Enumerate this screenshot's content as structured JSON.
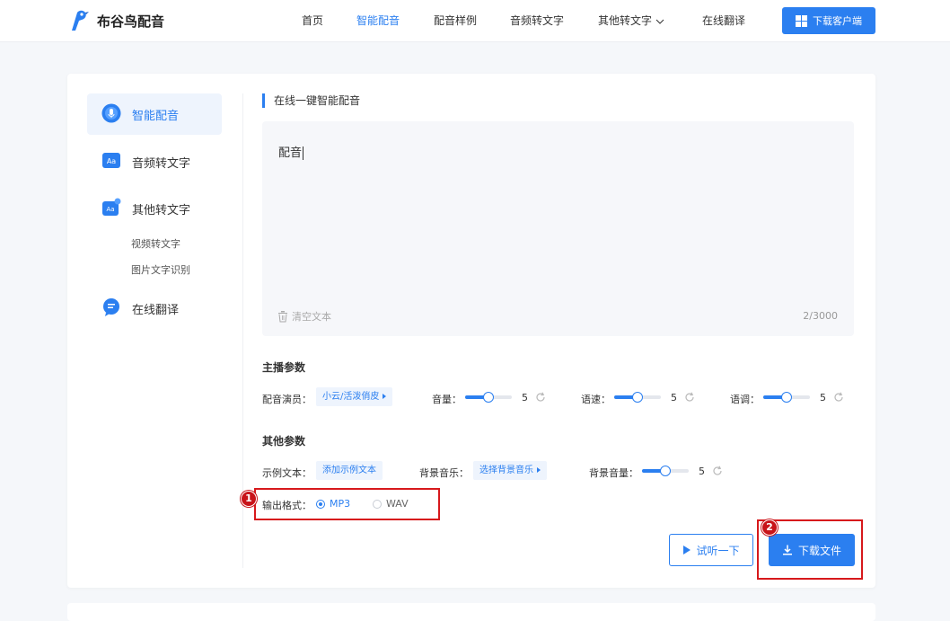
{
  "header": {
    "logo_text": "布谷鸟配音",
    "nav": [
      {
        "label": "首页",
        "active": false
      },
      {
        "label": "智能配音",
        "active": true
      },
      {
        "label": "配音样例",
        "active": false
      },
      {
        "label": "音频转文字",
        "active": false
      },
      {
        "label": "其他转文字",
        "active": false,
        "has_dropdown": true
      },
      {
        "label": "在线翻译",
        "active": false
      }
    ],
    "download_client_label": "下载客户端"
  },
  "sidebar": {
    "items": [
      {
        "label": "智能配音",
        "icon": "mic-icon",
        "active": true
      },
      {
        "label": "音频转文字",
        "icon": "aa-text-icon",
        "active": false
      },
      {
        "label": "其他转文字",
        "icon": "aa-convert-icon",
        "active": false
      },
      {
        "label": "在线翻译",
        "icon": "translate-chat-icon",
        "active": false
      }
    ],
    "subitems": [
      "视频转文字",
      "图片文字识别"
    ]
  },
  "main": {
    "section_title": "在线一键智能配音",
    "textarea": {
      "text": "配音",
      "clear_label": "清空文本",
      "counter": "2/3000"
    },
    "anchor_params": {
      "title": "主播参数",
      "voice_label": "配音演员：",
      "voice_value": "小云/活泼俏皮",
      "volume_label": "音量：",
      "volume_value": "5",
      "speed_label": "语速：",
      "speed_value": "5",
      "pitch_label": "语调：",
      "pitch_value": "5",
      "level_fraction": 0.5
    },
    "other_params": {
      "title": "其他参数",
      "sample_text_label": "示例文本：",
      "sample_text_btn": "添加示例文本",
      "bgm_label": "背景音乐：",
      "bgm_btn": "选择背景音乐",
      "bgm_volume_label": "背景音量：",
      "bgm_volume_value": "5",
      "format_label": "输出格式：",
      "formats": [
        {
          "label": "MP3",
          "selected": true
        },
        {
          "label": "WAV",
          "selected": false
        }
      ]
    },
    "preview_label": "试听一下",
    "download_label": "下载文件"
  },
  "annotations": {
    "marker1": "1",
    "marker2": "2"
  },
  "colors": {
    "accent": "#2b7ff0",
    "highlight": "#d7191c"
  }
}
